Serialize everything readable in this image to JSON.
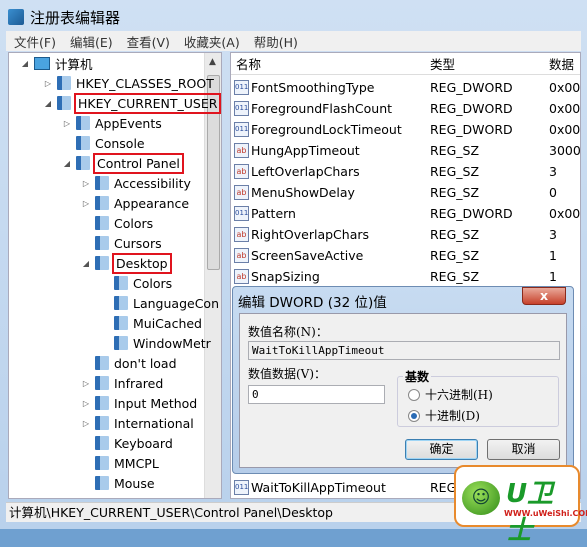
{
  "window": {
    "title": "注册表编辑器"
  },
  "menu": [
    "文件(F)",
    "编辑(E)",
    "查看(V)",
    "收藏夹(A)",
    "帮助(H)"
  ],
  "tree": [
    {
      "label": "计算机",
      "level": 0,
      "state": "expanded",
      "icon": "computer-icon"
    },
    {
      "label": "HKEY_CLASSES_ROOT",
      "level": 1,
      "state": "collapsed"
    },
    {
      "label": "HKEY_CURRENT_USER",
      "level": 1,
      "state": "expanded",
      "highlight": true
    },
    {
      "label": "AppEvents",
      "level": 2,
      "state": "collapsed"
    },
    {
      "label": "Console",
      "level": 2,
      "state": "none"
    },
    {
      "label": "Control Panel",
      "level": 2,
      "state": "expanded",
      "highlight": true
    },
    {
      "label": "Accessibility",
      "level": 3,
      "state": "collapsed"
    },
    {
      "label": "Appearance",
      "level": 3,
      "state": "collapsed"
    },
    {
      "label": "Colors",
      "level": 3,
      "state": "none"
    },
    {
      "label": "Cursors",
      "level": 3,
      "state": "none"
    },
    {
      "label": "Desktop",
      "level": 3,
      "state": "expanded",
      "highlight": true
    },
    {
      "label": "Colors",
      "level": 4,
      "state": "none"
    },
    {
      "label": "LanguageCon",
      "level": 4,
      "state": "none"
    },
    {
      "label": "MuiCached",
      "level": 4,
      "state": "none"
    },
    {
      "label": "WindowMetr",
      "level": 4,
      "state": "none"
    },
    {
      "label": "don't load",
      "level": 3,
      "state": "none"
    },
    {
      "label": "Infrared",
      "level": 3,
      "state": "collapsed"
    },
    {
      "label": "Input Method",
      "level": 3,
      "state": "collapsed"
    },
    {
      "label": "International",
      "level": 3,
      "state": "collapsed"
    },
    {
      "label": "Keyboard",
      "level": 3,
      "state": "none"
    },
    {
      "label": "MMCPL",
      "level": 3,
      "state": "none"
    },
    {
      "label": "Mouse",
      "level": 3,
      "state": "none"
    }
  ],
  "list": {
    "columns": [
      "名称",
      "类型",
      "数据"
    ],
    "rows": [
      {
        "name": "FontSmoothingType",
        "type": "REG_DWORD",
        "data": "0x00",
        "icon": "dword"
      },
      {
        "name": "ForegroundFlashCount",
        "type": "REG_DWORD",
        "data": "0x00",
        "icon": "dword"
      },
      {
        "name": "ForegroundLockTimeout",
        "type": "REG_DWORD",
        "data": "0x00",
        "icon": "dword"
      },
      {
        "name": "HungAppTimeout",
        "type": "REG_SZ",
        "data": "3000",
        "icon": "sz"
      },
      {
        "name": "LeftOverlapChars",
        "type": "REG_SZ",
        "data": "3",
        "icon": "sz"
      },
      {
        "name": "MenuShowDelay",
        "type": "REG_SZ",
        "data": "0",
        "icon": "sz"
      },
      {
        "name": "Pattern",
        "type": "REG_DWORD",
        "data": "0x00",
        "icon": "dword"
      },
      {
        "name": "RightOverlapChars",
        "type": "REG_SZ",
        "data": "3",
        "icon": "sz"
      },
      {
        "name": "ScreenSaveActive",
        "type": "REG_SZ",
        "data": "1",
        "icon": "sz"
      },
      {
        "name": "SnapSizing",
        "type": "REG_SZ",
        "data": "1",
        "icon": "sz"
      }
    ],
    "last_row": {
      "name": "WaitToKillAppTimeout",
      "type": "REG",
      "icon": "dword"
    }
  },
  "dialog": {
    "title": "编辑 DWORD (32 位)值",
    "close": "x",
    "name_label": "数值名称(N)：",
    "name_value": "WaitToKillAppTimeout",
    "data_label": "数值数据(V)：",
    "data_value": "0",
    "base_label": "基数",
    "hex_label": "十六进制(H)",
    "dec_label": "十进制(D)",
    "selected_base": "decimal",
    "ok": "确定",
    "cancel": "取消"
  },
  "status": "计算机\\HKEY_CURRENT_USER\\Control Panel\\Desktop",
  "watermark": {
    "text": "U卫士",
    "url": "WWW.uWeiShi.COM"
  }
}
